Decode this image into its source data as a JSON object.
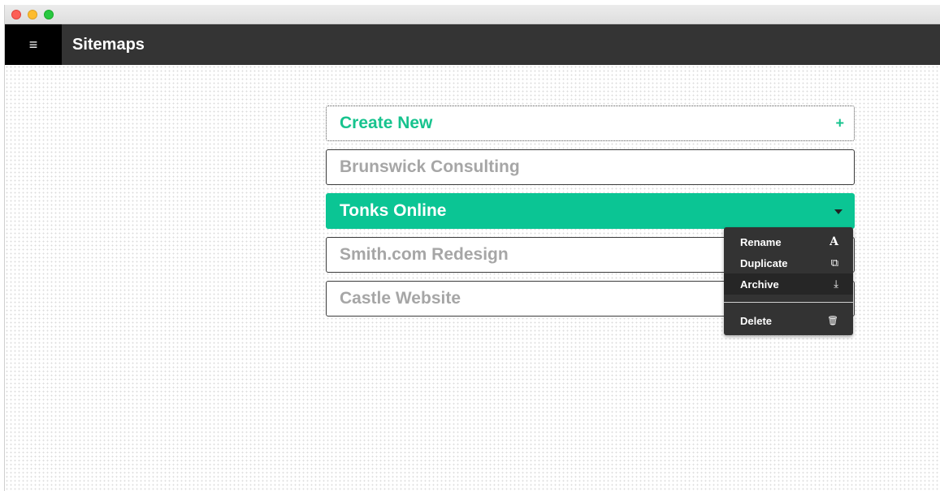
{
  "app": {
    "title": "Sitemaps",
    "menu_icon": "≡"
  },
  "create": {
    "label": "Create New",
    "icon": "+"
  },
  "sitemaps": [
    {
      "label": "Brunswick Consulting"
    },
    {
      "label": "Tonks Online"
    },
    {
      "label": "Smith.com Redesign"
    },
    {
      "label": "Castle Website"
    }
  ],
  "context_menu": {
    "items": [
      {
        "label": "Rename",
        "icon": "A"
      },
      {
        "label": "Duplicate",
        "icon": "⧉"
      },
      {
        "label": "Archive",
        "icon": "⤓"
      },
      {
        "label": "Delete",
        "icon": "🗑"
      }
    ]
  },
  "colors": {
    "accent": "#0bc594",
    "appbar": "#343434",
    "menu_bg": "#333333"
  }
}
